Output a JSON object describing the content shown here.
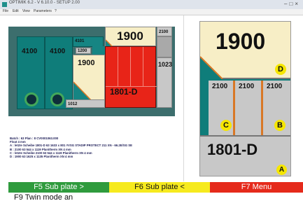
{
  "window": {
    "title": "OPTIMIK 6.2 - V 6.10.0 - SETUP 2.00"
  },
  "menu": [
    "File",
    "Edit",
    "View",
    "Parameters",
    "?"
  ],
  "layout_left": {
    "labels": {
      "p4100a": "4100",
      "p4100b": "4100",
      "p4101": "4101",
      "p1200": "1200",
      "p1900": "1900",
      "p1900b": "1900",
      "p2100": "2100",
      "p1023": "1023",
      "p1801": "1801-D",
      "p1012": "1012"
    }
  },
  "layout_right": {
    "labels": {
      "p1900": "1900",
      "p2100a": "2100",
      "p2100b": "2100",
      "p2100c": "2100",
      "p1801": "1801-D"
    },
    "markers": {
      "a": "A",
      "b": "B",
      "c": "C",
      "d": "D"
    }
  },
  "info": [
    "Batch : 63  Plan : 8  CV0001063.000",
    "Float 4 mm",
    "A : letzte Scheibe    1801-D    63    1633 x 801     #VSG STADIP PROTECT 211 XN - 66.2E/SG SE",
    "B : 2100    63    544 x 1119    Planitherm XN 4 mm",
    "C : letzte Scheibe    2100    63    544 x 1119    Planitherm XN 4 mm",
    "D : 1900    63    1625 x 1135    Planitherm XN 4 mm"
  ],
  "buttons": {
    "f5": "F5 Sub plate >",
    "f6": "F6 Sub plate <",
    "f7": "F7 Menu",
    "f9": "F9 Twin mode an"
  },
  "colors": {
    "teal": "#0f7d7a",
    "cream": "#f7eec6",
    "red": "#e82418",
    "gray": "#c8c8c8",
    "yellow": "#f5e600",
    "green": "#2f9b3d"
  }
}
